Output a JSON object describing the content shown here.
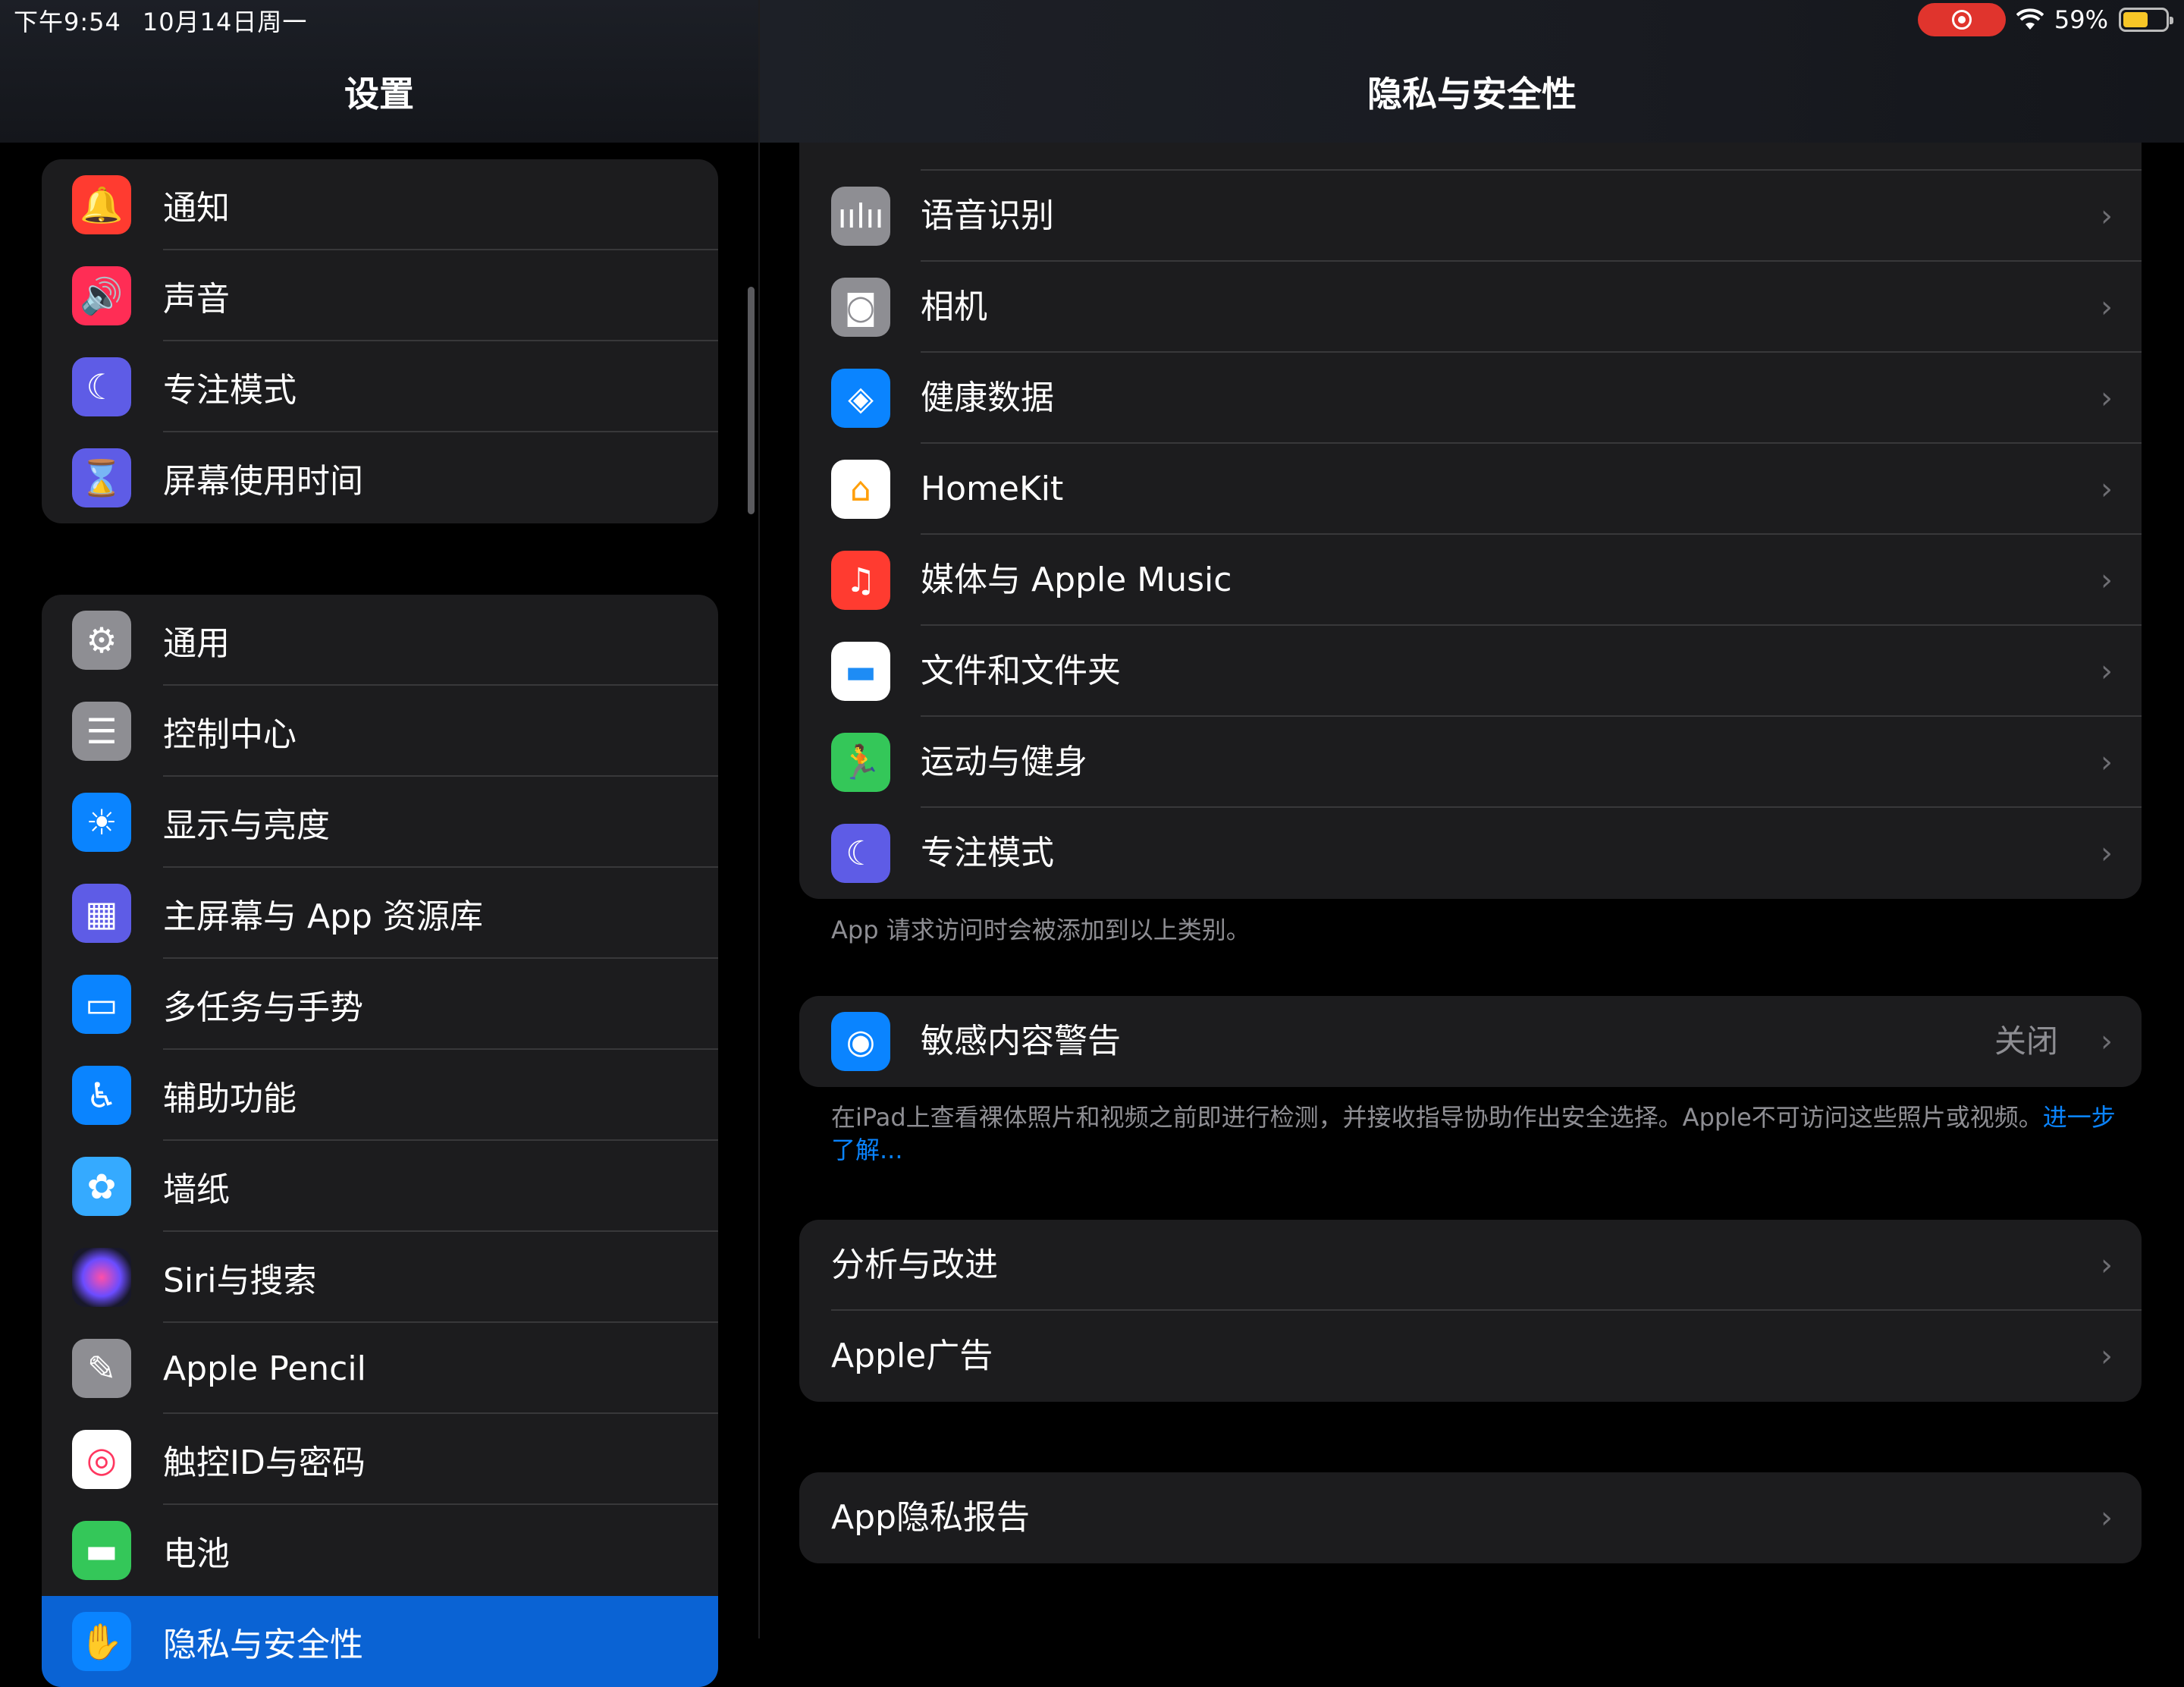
{
  "status_bar": {
    "time": "下午9:54",
    "date": "10月14日周一",
    "battery_percent": "59%",
    "battery_level": 0.59
  },
  "sidebar": {
    "title": "设置",
    "group1": [
      {
        "label": "通知",
        "icon": "bell-icon",
        "color": "#ff3b30"
      },
      {
        "label": "声音",
        "icon": "speaker-icon",
        "color": "#ff2d55"
      },
      {
        "label": "专注模式",
        "icon": "moon-icon",
        "color": "#5e5ce6"
      },
      {
        "label": "屏幕使用时间",
        "icon": "hourglass-icon",
        "color": "#5e5ce6"
      }
    ],
    "group2": [
      {
        "label": "通用",
        "icon": "gear-icon",
        "color": "#8e8e93"
      },
      {
        "label": "控制中心",
        "icon": "toggles-icon",
        "color": "#8e8e93"
      },
      {
        "label": "显示与亮度",
        "icon": "sun-icon",
        "color": "#0a84ff"
      },
      {
        "label": "主屏幕与 App 资源库",
        "icon": "app-grid-icon",
        "color": "#5e5ce6"
      },
      {
        "label": "多任务与手势",
        "icon": "multitask-icon",
        "color": "#0a84ff"
      },
      {
        "label": "辅助功能",
        "icon": "accessibility-icon",
        "color": "#0a84ff"
      },
      {
        "label": "墙纸",
        "icon": "flower-icon",
        "color": "#35aaff"
      },
      {
        "label": "Siri与搜索",
        "icon": "siri-icon",
        "color": "#1c1c2e"
      },
      {
        "label": "Apple Pencil",
        "icon": "pencil-icon",
        "color": "#8e8e93"
      },
      {
        "label": "触控ID与密码",
        "icon": "fingerprint-icon",
        "color": "#ffffff"
      },
      {
        "label": "电池",
        "icon": "battery-icon",
        "color": "#34c759"
      },
      {
        "label": "隐私与安全性",
        "icon": "hand-icon",
        "color": "#0a84ff"
      }
    ]
  },
  "main": {
    "title": "隐私与安全性",
    "categories": [
      {
        "label": "语音识别",
        "icon": "waveform-icon",
        "color": "#8e8e93"
      },
      {
        "label": "相机",
        "icon": "camera-icon",
        "color": "#8e8e93"
      },
      {
        "label": "健康数据",
        "icon": "health-icon",
        "color": "#0a84ff"
      },
      {
        "label": "HomeKit",
        "icon": "home-icon",
        "color": "#ffffff"
      },
      {
        "label": "媒体与 Apple Music",
        "icon": "music-icon",
        "color": "#ff3b30"
      },
      {
        "label": "文件和文件夹",
        "icon": "folder-icon",
        "color": "#ffffff"
      },
      {
        "label": "运动与健身",
        "icon": "running-icon",
        "color": "#34c759"
      },
      {
        "label": "专注模式",
        "icon": "moon-icon",
        "color": "#5e5ce6"
      }
    ],
    "categories_footnote": "App 请求访问时会被添加到以上类别。",
    "sensitive": {
      "label": "敏感内容警告",
      "value": "关闭",
      "icon": "eye-warning-icon",
      "color": "#0a84ff",
      "footnote": "在iPad上查看裸体照片和视频之前即进行检测，并接收指导协助作出安全选择。Apple不可访问这些照片或视频。",
      "link": "进一步了解..."
    },
    "analytics": [
      {
        "label": "分析与改进"
      },
      {
        "label": "Apple广告"
      }
    ],
    "report": {
      "label": "App隐私报告"
    },
    "chevron": "›"
  }
}
